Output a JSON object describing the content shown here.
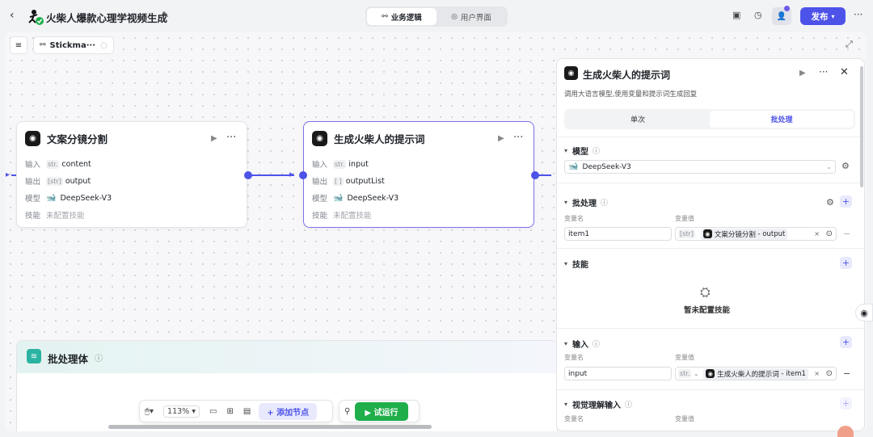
{
  "header": {
    "title": "火柴人爆款心理学视频生成",
    "tabs": [
      {
        "label": "业务逻辑",
        "active": true
      },
      {
        "label": "用户界面",
        "active": false
      }
    ],
    "publish_label": "发布"
  },
  "canvas": {
    "workflow_name": "Stickma···",
    "zoom": "113%",
    "add_node_label": "添加节点",
    "run_label": "试运行"
  },
  "nodes": [
    {
      "title": "文案分镜分割",
      "input_label": "输入",
      "input_type": "str.",
      "input_value": "content",
      "output_label": "输出",
      "output_type": "[str]",
      "output_value": "output",
      "model_label": "模型",
      "model_value": "DeepSeek-V3",
      "skill_label": "技能",
      "skill_value": "未配置技能"
    },
    {
      "title": "生成火柴人的提示词",
      "input_label": "输入",
      "input_type": "str.",
      "input_value": "input",
      "output_label": "输出",
      "output_type": "[ ]",
      "output_value": "outputList",
      "model_label": "模型",
      "model_value": "DeepSeek-V3",
      "skill_label": "技能",
      "skill_value": "未配置技能"
    }
  ],
  "batch_body": {
    "title": "批处理体"
  },
  "panel": {
    "title": "生成火柴人的提示词",
    "description": "调用大语言模型,使用变量和提示词生成回复",
    "mode_single": "单次",
    "mode_batch": "批处理",
    "model_section": "模型",
    "model_value": "DeepSeek-V3",
    "batch_section": "批处理",
    "var_name_header": "变量名",
    "var_value_header": "变量值",
    "batch_var_name": "item1",
    "batch_var_type": "[str]",
    "batch_ref_node": "文案分镜分割",
    "batch_ref_field": "output",
    "skills_section": "技能",
    "skills_empty": "暂未配置技能",
    "input_section": "输入",
    "input_var_name": "input",
    "input_var_type": "str.",
    "input_ref_node": "生成火柴人的提示词",
    "input_ref_field": "item1",
    "vision_section": "视觉理解输入"
  },
  "colors": {
    "accent": "#4d53e8",
    "run": "#1fae4a",
    "batch": "#2bb3a1"
  }
}
